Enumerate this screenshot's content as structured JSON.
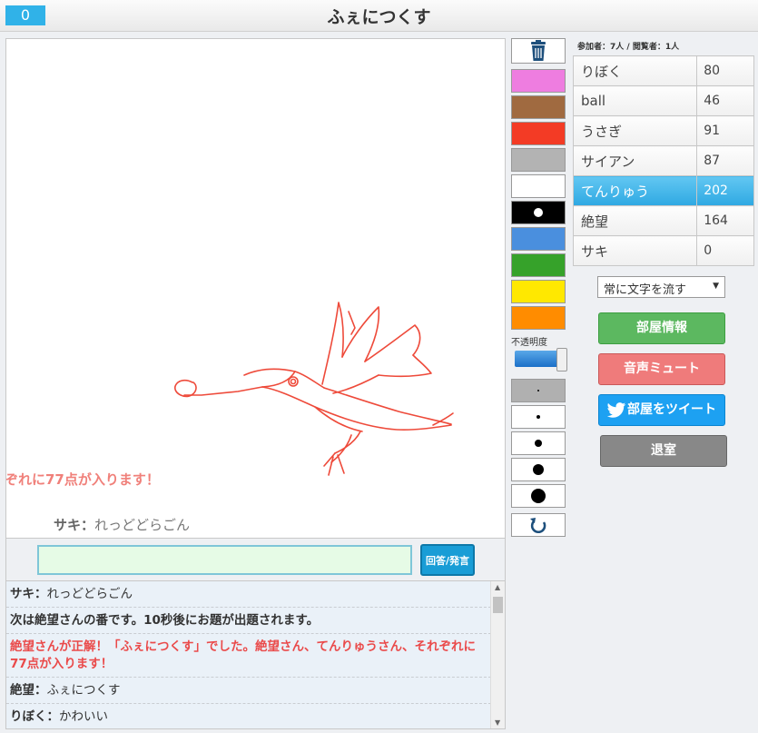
{
  "header": {
    "timer": "0",
    "title": "ふぇにつくす"
  },
  "canvas": {
    "flowing_text": "ぞれに77点が入ります！",
    "last_message": {
      "name": "サキ",
      "text": "れっどどらごん"
    }
  },
  "input": {
    "value": "",
    "button_label": "回答/発言"
  },
  "chat": [
    {
      "name": "サキ",
      "text": "れっどどらごん",
      "style": "normal"
    },
    {
      "name": "",
      "text": "次は絶望さんの番です。10秒後にお題が出題されます。",
      "style": "sys"
    },
    {
      "name": "",
      "text": "絶望さんが正解！「ふぇにつくす」でした。絶望さん、てんりゅうさん、それぞれに77点が入ります！",
      "style": "red"
    },
    {
      "name": "絶望",
      "text": "ふぇにつくす",
      "style": "normal"
    },
    {
      "name": "りぼく",
      "text": "かわいい",
      "style": "normal"
    }
  ],
  "tools": {
    "colors": [
      "#ee7de0",
      "#a06a40",
      "#f33b25",
      "#b3b3b3",
      "#ffffff",
      "#000000",
      "#4a8fde",
      "#36a22a",
      "#ffe800",
      "#ff8c00"
    ],
    "selected_color_index": 5,
    "opacity_label": "不透明度",
    "opacity_level_percent": 95,
    "brush_sizes": [
      2,
      4,
      8,
      12,
      16
    ]
  },
  "room": {
    "counts_text": "参加者：7人 / 閲覧者：1人"
  },
  "players": [
    {
      "name": "りぼく",
      "score": "80",
      "active": false
    },
    {
      "name": "ball",
      "score": "46",
      "active": false
    },
    {
      "name": "うさぎ",
      "score": "91",
      "active": false
    },
    {
      "name": "サイアン",
      "score": "87",
      "active": false
    },
    {
      "name": "てんりゅう",
      "score": "202",
      "active": true
    },
    {
      "name": "絶望",
      "score": "164",
      "active": false
    },
    {
      "name": "サキ",
      "score": "0",
      "active": false
    }
  ],
  "controls": {
    "flow_select": "常に文字を流す",
    "room_info": "部屋情報",
    "mute": "音声ミュート",
    "tweet": "部屋をツイート",
    "leave": "退室"
  },
  "colors": {
    "accent": "#30b2e8",
    "drawing_stroke": "#ee4a3a"
  }
}
